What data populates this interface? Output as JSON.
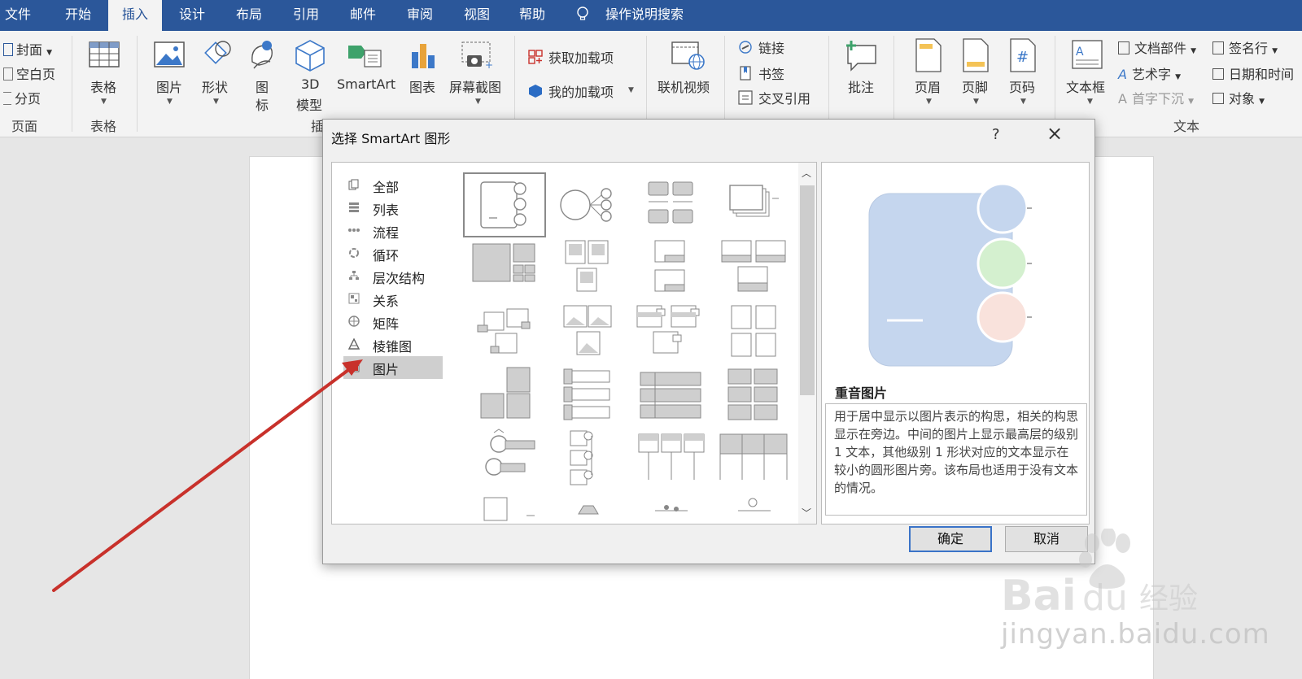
{
  "tabs": [
    "文件",
    "开始",
    "插入",
    "设计",
    "布局",
    "引用",
    "邮件",
    "审阅",
    "视图",
    "帮助"
  ],
  "active_tab": "插入",
  "search_label": "操作说明搜索",
  "ribbon": {
    "pages_group": {
      "items": [
        "封面",
        "空白页",
        "分页"
      ],
      "label": "页面"
    },
    "table_group": {
      "button": "表格",
      "label": "表格"
    },
    "illustrations": {
      "picture": "图片",
      "shapes": "形状",
      "icons_1": "图",
      "icons_2": "标",
      "model_1": "3D",
      "model_2": "模型",
      "smartart": "SmartArt",
      "chart": "图表",
      "screenshot": "屏幕截图",
      "label_partial": "插"
    },
    "addins": {
      "get": "获取加载项",
      "mine": "我的加载项"
    },
    "media": {
      "online_video": "联机视频"
    },
    "links": {
      "link": "链接",
      "bookmark": "书签",
      "cross_ref": "交叉引用"
    },
    "comments": {
      "comment": "批注"
    },
    "header_footer": {
      "header": "页眉",
      "footer": "页脚",
      "page_number": "页码"
    },
    "text_group": {
      "textbox": "文本框",
      "quick_parts": "文档部件",
      "wordart": "艺术字",
      "dropcap": "首字下沉",
      "signature": "签名行",
      "datetime": "日期和时间",
      "object": "对象",
      "label": "文本"
    }
  },
  "dialog": {
    "title": "选择 SmartArt 图形",
    "help": "?",
    "categories": [
      "全部",
      "列表",
      "流程",
      "循环",
      "层次结构",
      "关系",
      "矩阵",
      "棱锥图",
      "图片"
    ],
    "selected_category": "图片",
    "preview_title": "重音图片",
    "preview_description": "用于居中显示以图片表示的构思，相关的构思显示在旁边。中间的图片上显示最高层的级别 1 文本，其他级别 1 形状对应的文本显示在较小的圆形图片旁。该布局也适用于没有文本的情况。",
    "ok": "确定",
    "cancel": "取消"
  },
  "watermark": {
    "text": "jingyan.baidu.com"
  },
  "colors": {
    "ribbon_blue": "#2b579a",
    "arrow": "#c8312b",
    "preview_blue": "#c5d6ee",
    "preview_green": "#d4f0cf",
    "preview_pink": "#f9e2dc"
  }
}
